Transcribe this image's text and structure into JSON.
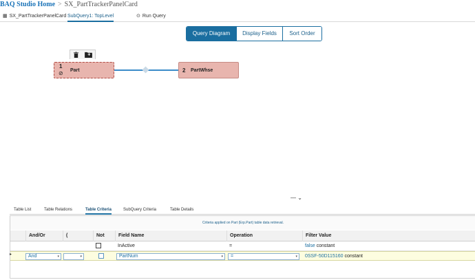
{
  "breadcrumb": {
    "home": "BAQ Studio Home",
    "sep": ">",
    "current": "SX_PartTrackerPanelCard"
  },
  "tabs": [
    {
      "label": "SX_PartTrackerPanelCard",
      "icon": "grid-icon"
    },
    {
      "label": "SubQuery1: TopLevel",
      "active": true
    },
    {
      "label": "Run Query",
      "icon": "play-icon"
    }
  ],
  "view_switch": [
    "Query Diagram",
    "Display Fields",
    "Sort Order"
  ],
  "diagram": {
    "nodes": [
      {
        "num": "1",
        "name": "Part"
      },
      {
        "num": "2",
        "name": "PartWhse"
      }
    ]
  },
  "collapse_glyph": "— ⌄",
  "subtabs": [
    "Table List",
    "Table Relations",
    "Table Criteria",
    "SubQuery Criteria",
    "Table Details"
  ],
  "criteria_caption": "Criteria applied on Part (Erp.Part) table data retrieval.",
  "columns": [
    "And/Or",
    "(",
    "Not",
    "Field Name",
    "Operation",
    "Filter Value"
  ],
  "rows": [
    {
      "andor": "",
      "paren": "",
      "not": false,
      "field": "InActive",
      "operation": "=",
      "filter_kw": "false",
      "filter_type": "constant"
    },
    {
      "andor": "And",
      "paren": "",
      "not": false,
      "field": "PartNum",
      "operation": "=",
      "filter_kw": "0SSF-50D115160",
      "filter_type": "constant"
    }
  ],
  "colors": {
    "accent": "#1a6ea0",
    "node_fill": "#e8b5ae",
    "edit_row": "#fdfde0"
  }
}
